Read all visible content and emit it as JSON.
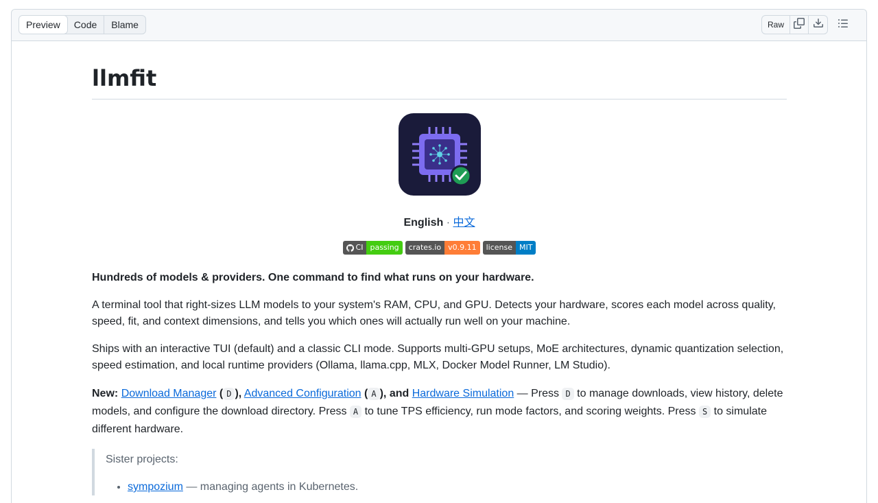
{
  "toolbar": {
    "tabs": [
      "Preview",
      "Code",
      "Blame"
    ],
    "raw_label": "Raw",
    "icons": [
      "copy-icon",
      "download-icon",
      "list-unordered-icon"
    ]
  },
  "readme": {
    "title": "llmfit",
    "lang_current": "English",
    "lang_sep": " · ",
    "lang_other": "中文",
    "badges": [
      {
        "label": "CI",
        "value": "passing",
        "color": "#4c1"
      },
      {
        "label": "crates.io",
        "value": "v0.9.11",
        "color": "#fe7d37"
      },
      {
        "label": "license",
        "value": "MIT",
        "color": "#007ec6"
      }
    ],
    "tagline": "Hundreds of models & providers. One command to find what runs on your hardware.",
    "para1": "A terminal tool that right-sizes LLM models to your system's RAM, CPU, and GPU. Detects your hardware, scores each model across quality, speed, fit, and context dimensions, and tells you which ones will actually run well on your machine.",
    "para2": "Ships with an interactive TUI (default) and a classic CLI mode. Supports multi-GPU setups, MoE architectures, dynamic quantization selection, speed estimation, and local runtime providers (Ollama, llama.cpp, MLX, Docker Model Runner, LM Studio).",
    "new": {
      "label": "New:",
      "link1": "Download Manager",
      "key1": "D",
      "link2": "Advanced Configuration",
      "key2": "A",
      "and_text": ", and",
      "link3": "Hardware Simulation",
      "t1": " — Press ",
      "t2": " to manage downloads, view history, delete models, and configure the download directory. Press ",
      "t3": " to tune TPS efficiency, run mode factors, and scoring weights. Press ",
      "key3": "S",
      "t4": " to simulate different hardware."
    },
    "sister": {
      "heading": "Sister projects:",
      "items": [
        {
          "link": "sympozium",
          "desc": " — managing agents in Kubernetes."
        }
      ]
    }
  },
  "colors": {
    "link": "#0969da",
    "logo_bg": "#1a1b3a",
    "chip": "#7c6cf0",
    "check": "#1f9d55"
  }
}
